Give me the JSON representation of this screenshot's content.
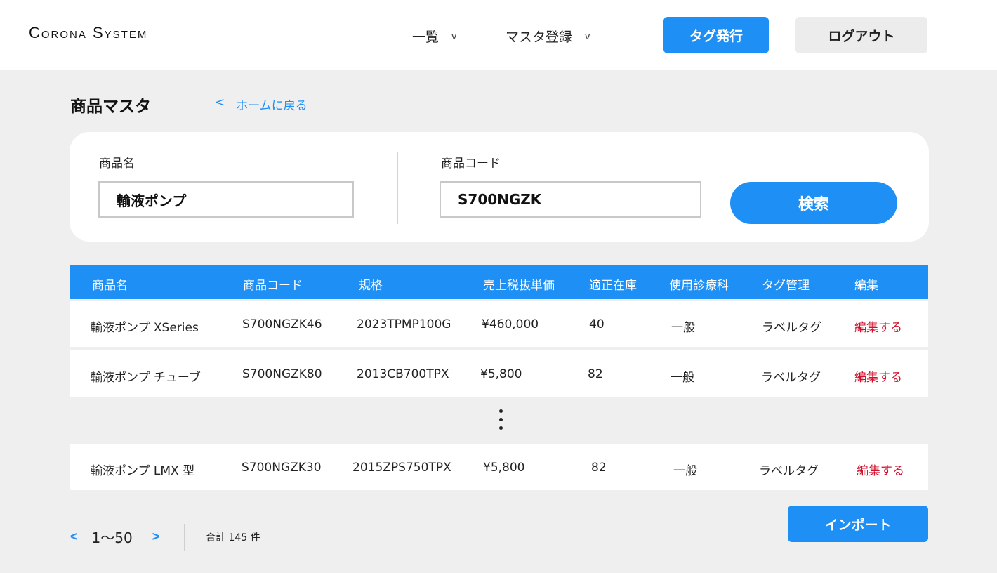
{
  "header": {
    "logo": "Corona System",
    "nav": [
      {
        "label": "一覧",
        "chevron": "v"
      },
      {
        "label": "マスタ登録",
        "chevron": "v"
      }
    ],
    "tag_button": "タグ発行",
    "logout_button": "ログアウト"
  },
  "page": {
    "title": "商品マスタ",
    "back_arrow": "<",
    "back_label": "ホームに戻る"
  },
  "search": {
    "name_label": "商品名",
    "name_value": "輸液ポンプ",
    "code_label": "商品コード",
    "code_value": "S700NGZK",
    "search_button": "検索"
  },
  "table": {
    "columns": [
      "商品名",
      "商品コード",
      "規格",
      "売上税抜単価",
      "適正在庫",
      "使用診療科",
      "タグ管理",
      "編集"
    ],
    "rows": [
      [
        "輸液ポンプ XSeries",
        "S700NGZK46",
        "2023TPMP100G",
        "¥460,000",
        "40",
        "一般",
        "ラベルタグ",
        "編集する"
      ],
      [
        "輸液ポンプ チューブ",
        "S700NGZK80",
        "2013CB700TPX",
        "¥5,800",
        "82",
        "一般",
        "ラベルタグ",
        "編集する"
      ],
      [
        "輸液ポンプ LMX 型",
        "S700NGZK30",
        "2015ZPS750TPX",
        "¥5,800",
        "82",
        "一般",
        "ラベルタグ",
        "編集する"
      ]
    ]
  },
  "pager": {
    "prev": "<",
    "range": "1〜50",
    "next": ">",
    "total": "合計 145 件"
  },
  "import_button": "インポート",
  "colors": {
    "accent": "#1e8ff5",
    "edit_link": "#d0102c",
    "background": "#efefef"
  }
}
